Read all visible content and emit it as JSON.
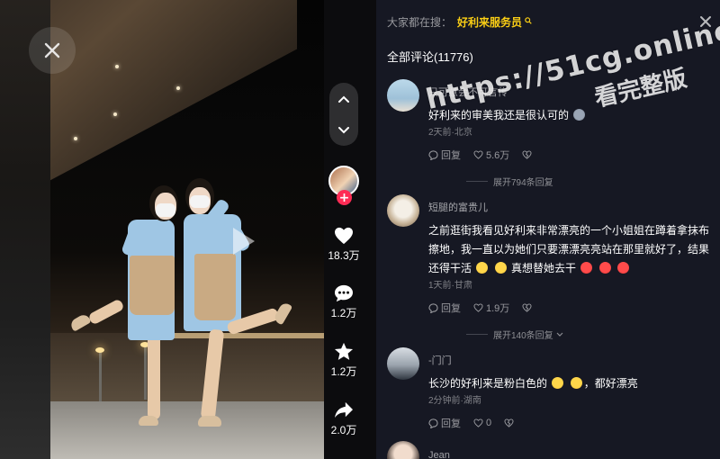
{
  "video": {
    "close_icon": "close-icon",
    "nav": {
      "up_icon": "chevron-up-icon",
      "down_icon": "chevron-down-icon"
    },
    "follow_symbol": "+",
    "actions": {
      "likes": "18.3万",
      "comments": "1.2万",
      "favorites": "1.2万",
      "shares": "2.0万"
    }
  },
  "panel": {
    "search_prefix": "大家都在搜：",
    "search_term": "好利来服务员",
    "comments_title": "全部评论(11776)",
    "reply_label": "回复"
  },
  "comments": [
    {
      "name": "只可意会不可言传",
      "text": "好利来的审美我还是很认可的",
      "time_location": "2天前·北京",
      "likes": "5.6万",
      "expand": "展开794条回复"
    },
    {
      "name": "短腿的富贵儿",
      "text_part1": "之前逛街我看见好利来非常漂亮的一个小姐姐在蹲着拿抹布擦地，我一直以为她们只要漂漂亮亮站在那里就好了，结果还得干活",
      "text_part2": "真想替她去干",
      "time_location": "1天前·甘肃",
      "likes": "1.9万",
      "expand": "展开140条回复"
    },
    {
      "name": "-门门",
      "text_part1": "长沙的好利来是粉白色的",
      "text_part2": "，都好漂亮",
      "time_location": "2分钟前·湖南",
      "likes": "0"
    },
    {
      "name": "Jean"
    }
  ],
  "watermark": {
    "line1": "https://51cg.online",
    "line2": "看完整版"
  },
  "colors": {
    "accent_search": "#face15",
    "follow_red": "#fe2c55",
    "panel_bg": "#161823"
  }
}
